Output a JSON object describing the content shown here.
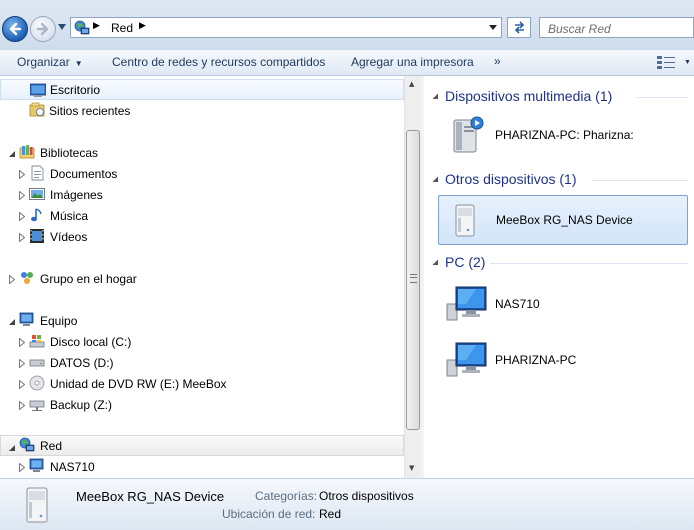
{
  "address_bar": {
    "path": "Red",
    "search_placeholder": "Buscar Red"
  },
  "toolbar": {
    "organize": "Organizar",
    "network_center": "Centro de redes y recursos compartidos",
    "add_printer": "Agregar una impresora",
    "more": "»"
  },
  "nav": {
    "escritorio": "Escritorio",
    "recientes": "Sitios recientes",
    "bibliotecas": "Bibliotecas",
    "documentos": "Documentos",
    "imagenes": "Imágenes",
    "musica": "Música",
    "videos": "Vídeos",
    "grupo_hogar": "Grupo en el hogar",
    "equipo": "Equipo",
    "disco_local": "Disco local (C:)",
    "datos": "DATOS (D:)",
    "dvd": "Unidad de DVD RW (E:) MeeBox",
    "backup": "Backup (Z:)",
    "red": "Red",
    "nas710": "NAS710"
  },
  "content": {
    "groups": [
      {
        "title": "Dispositivos multimedia (1)",
        "items": [
          "PHARIZNA-PC: Pharizna:"
        ]
      },
      {
        "title": "Otros dispositivos (1)",
        "items": [
          "MeeBox RG_NAS Device"
        ]
      },
      {
        "title": "PC (2)",
        "items": [
          "NAS710",
          "PHARIZNA-PC"
        ]
      }
    ]
  },
  "details": {
    "name": "MeeBox RG_NAS Device",
    "category_label": "Categorías:",
    "category_value": "Otros dispositivos",
    "location_label": "Ubicación de red:",
    "location_value": "Red"
  },
  "colors": {
    "group_title": "#1e3287",
    "toolbar_text": "#1e395b",
    "selection_border": "#7da2ce"
  }
}
